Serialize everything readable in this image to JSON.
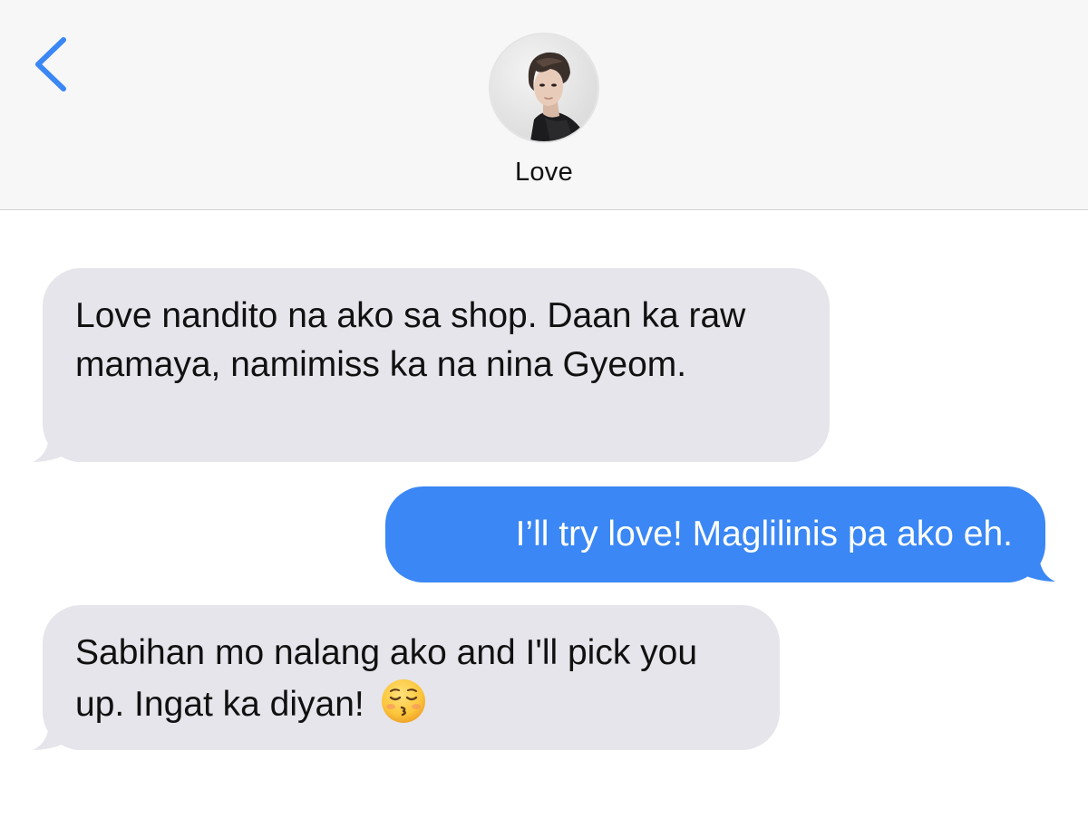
{
  "header": {
    "back_icon": "chevron-left-icon",
    "contact_name": "Love",
    "accent_color": "#3a87f5"
  },
  "messages": [
    {
      "direction": "received",
      "text": "Love nandito na ako sa shop. Daan ka raw mamaya, namimiss ka na nina Gyeom."
    },
    {
      "direction": "sent",
      "text": "I’ll try love! Maglilinis pa ako eh."
    },
    {
      "direction": "received",
      "text": "Sabihan mo nalang ako and I'll pick you up. Ingat ka diyan!",
      "emoji": "kissing-face-with-closed-eyes"
    }
  ],
  "colors": {
    "received_bubble": "#e6e5eb",
    "sent_bubble": "#3a87f5",
    "header_bg": "#f7f7f7"
  }
}
